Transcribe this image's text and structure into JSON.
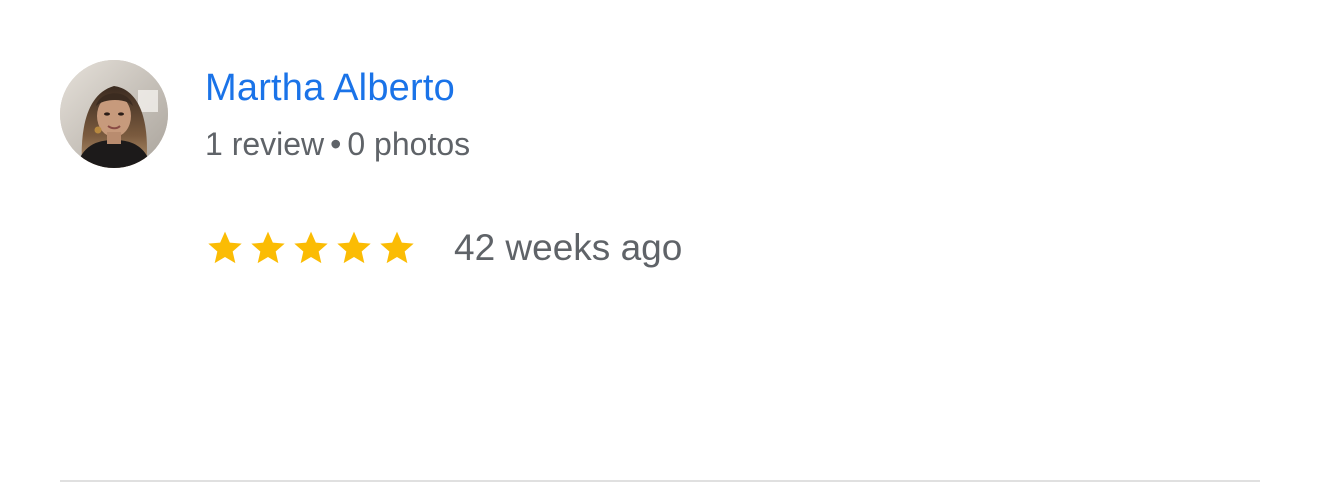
{
  "review": {
    "reviewer_name": "Martha Alberto",
    "reviews_count": "1 review",
    "separator": "•",
    "photos_count": "0 photos",
    "rating": 5,
    "rating_max": 5,
    "time_ago": "42 weeks ago",
    "avatar_icon": "profile-photo"
  },
  "colors": {
    "name_link": "#1a73e8",
    "secondary_text": "#5f6368",
    "star_filled": "#fbbc04",
    "divider": "#e0e0e0"
  }
}
